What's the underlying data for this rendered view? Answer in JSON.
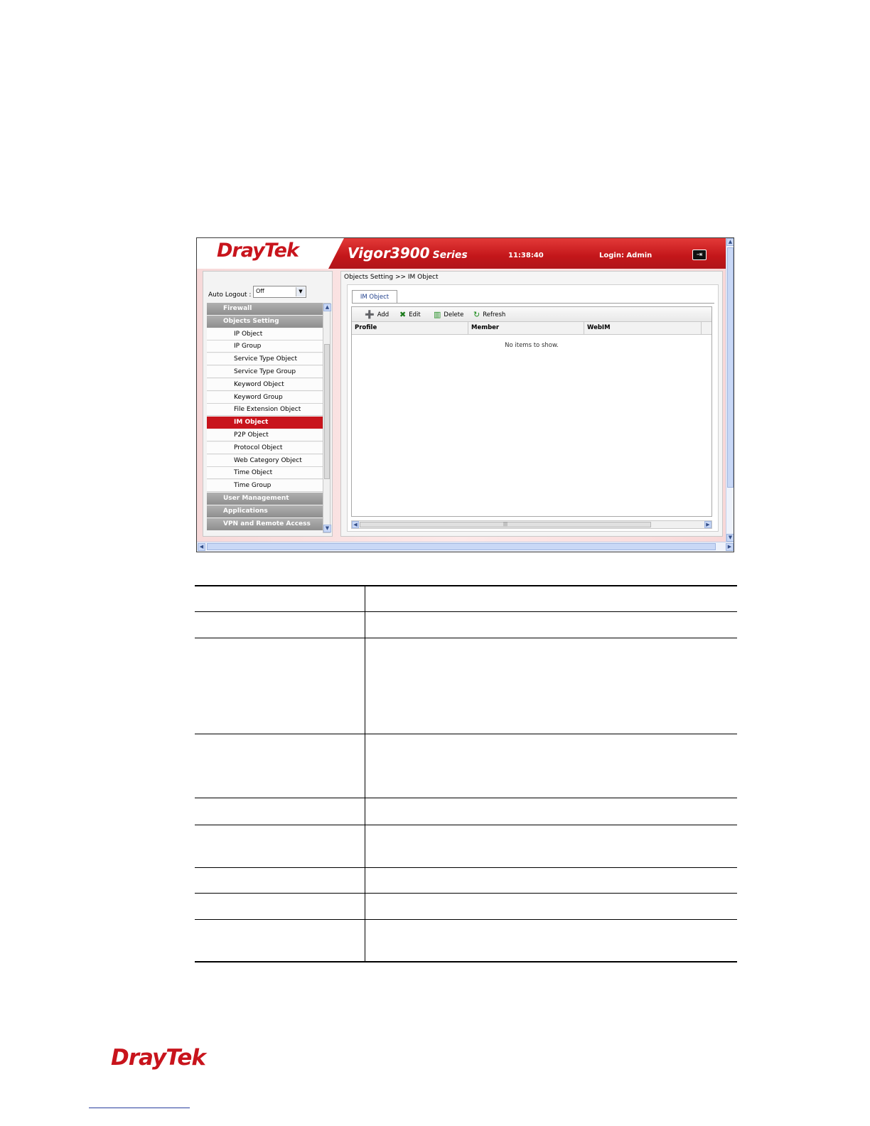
{
  "header": {
    "logo": "DrayTek",
    "product_model": "Vigor3900",
    "product_series": "Series",
    "time": "11:38:40",
    "login": "Login: Admin"
  },
  "sidebar": {
    "auto_logout_label": "Auto Logout :",
    "auto_logout_value": "Off",
    "items": [
      {
        "label": "Firewall",
        "type": "group"
      },
      {
        "label": "Objects Setting",
        "type": "group"
      },
      {
        "label": "IP Object",
        "type": "sub"
      },
      {
        "label": "IP Group",
        "type": "sub"
      },
      {
        "label": "Service Type Object",
        "type": "sub"
      },
      {
        "label": "Service Type Group",
        "type": "sub"
      },
      {
        "label": "Keyword Object",
        "type": "sub"
      },
      {
        "label": "Keyword Group",
        "type": "sub"
      },
      {
        "label": "File Extension Object",
        "type": "sub"
      },
      {
        "label": "IM Object",
        "type": "sub",
        "active": true
      },
      {
        "label": "P2P Object",
        "type": "sub"
      },
      {
        "label": "Protocol Object",
        "type": "sub"
      },
      {
        "label": "Web Category Object",
        "type": "sub"
      },
      {
        "label": "Time Object",
        "type": "sub"
      },
      {
        "label": "Time Group",
        "type": "sub"
      },
      {
        "label": "User Management",
        "type": "group"
      },
      {
        "label": "Applications",
        "type": "group"
      },
      {
        "label": "VPN and Remote Access",
        "type": "group"
      }
    ]
  },
  "main": {
    "breadcrumb": "Objects Setting >> IM Object",
    "tab": "IM Object",
    "toolbar": {
      "add": "Add",
      "edit": "Edit",
      "delete": "Delete",
      "refresh": "Refresh"
    },
    "columns": [
      "Profile",
      "Member",
      "WebIM"
    ],
    "empty_message": "No items to show."
  },
  "footer": {
    "logo": "DrayTek"
  },
  "colors": {
    "brand_red": "#c8141c",
    "menu_group_gray": "#9e9e9e"
  }
}
